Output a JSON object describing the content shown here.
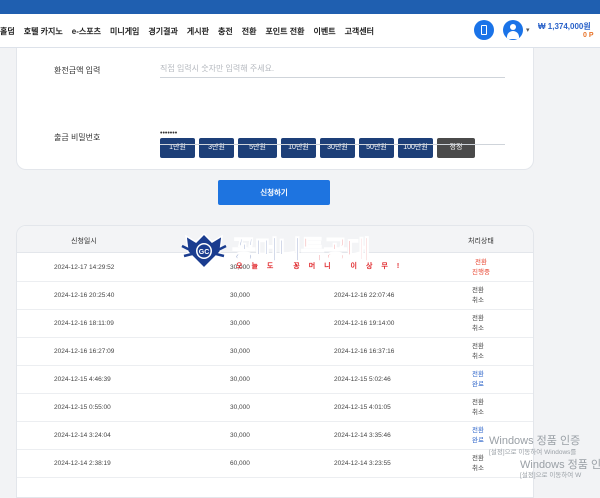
{
  "nav": {
    "items": [
      "홀덤",
      "호텔 카지노",
      "e-스포츠",
      "미니게임",
      "경기결과",
      "게시판",
      "충전",
      "전환",
      "포인트 전환",
      "이벤트",
      "고객센터"
    ],
    "balance": "₩ 1,374,000원",
    "points": "0 P"
  },
  "form": {
    "amount_label": "환전금액 입력",
    "amount_placeholder": "직접 입력시 숫자만 입력해 주세요.",
    "amount_buttons": [
      "1만원",
      "3만원",
      "5만원",
      "10만원",
      "30만원",
      "50만원",
      "100만원"
    ],
    "reset_label": "정정",
    "password_label": "출금 비밀번호",
    "password_value": "•••••••",
    "submit_label": "신청하기"
  },
  "table": {
    "headers": [
      "신청일시",
      "",
      "",
      "처리상태"
    ],
    "rows": [
      {
        "requested": "2024-12-17 14:29:52",
        "amount": "30,000",
        "processed": "",
        "status": "전환",
        "sub": "진행중"
      },
      {
        "requested": "2024-12-16 20:25:40",
        "amount": "30,000",
        "processed": "2024-12-16 22:07:46",
        "status": "전환",
        "sub": "취소"
      },
      {
        "requested": "2024-12-16 18:11:09",
        "amount": "30,000",
        "processed": "2024-12-16 19:14:00",
        "status": "전환",
        "sub": "취소"
      },
      {
        "requested": "2024-12-16 16:27:09",
        "amount": "30,000",
        "processed": "2024-12-16 16:37:16",
        "status": "전환",
        "sub": "취소"
      },
      {
        "requested": "2024-12-15 4:46:39",
        "amount": "30,000",
        "processed": "2024-12-15 5:02:46",
        "status": "전환",
        "sub": "완료"
      },
      {
        "requested": "2024-12-15 0:55:00",
        "amount": "30,000",
        "processed": "2024-12-15 4:01:05",
        "status": "전환",
        "sub": "취소"
      },
      {
        "requested": "2024-12-14 3:24:04",
        "amount": "30,000",
        "processed": "2024-12-14 3:35:46",
        "status": "전환",
        "sub": "완료"
      },
      {
        "requested": "2024-12-14 2:38:19",
        "amount": "60,000",
        "processed": "2024-12-14 3:23:55",
        "status": "전환",
        "sub": "취소"
      }
    ]
  },
  "logo": {
    "text_blue": "꽁머니",
    "text_red": "특공대",
    "tagline": "오늘도 꽁머니 이상무!",
    "badge": "GC"
  },
  "watermark": {
    "line1": "Windows 정품 인증",
    "line2": "[설정]으로 이동하여 Windows를",
    "line3": "Windows 정품 인",
    "line4": "[설정]으로 이동하여 W"
  },
  "colors": {
    "accent": "#1e74e0",
    "navy_button": "#1d3f78",
    "status_pending": "#e8432e",
    "status_done": "#2a62c9"
  }
}
